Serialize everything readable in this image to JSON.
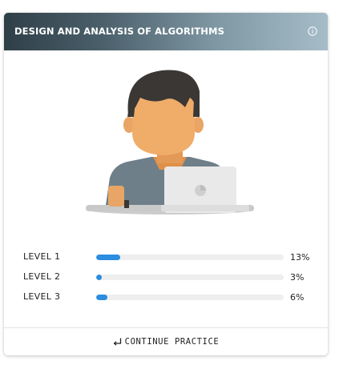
{
  "card": {
    "title": "DESIGN AND ANALYSIS OF ALGORITHMS",
    "info_icon": "info-icon"
  },
  "illustration": {
    "icon": "student-laptop-illustration"
  },
  "levels": [
    {
      "label": "LEVEL 1",
      "percent_text": "13%",
      "progress": 0.13
    },
    {
      "label": "LEVEL 2",
      "percent_text": "3%",
      "progress": 0.03
    },
    {
      "label": "LEVEL 3",
      "percent_text": "6%",
      "progress": 0.06
    }
  ],
  "footer": {
    "continue_label": "CONTINUE PRACTICE",
    "continue_icon": "return-arrow-icon"
  },
  "colors": {
    "progress_fill": "#2a8de0",
    "progress_track": "#eeeeee",
    "header_dark": "#2f3f48",
    "header_light": "#a6bdc8"
  }
}
